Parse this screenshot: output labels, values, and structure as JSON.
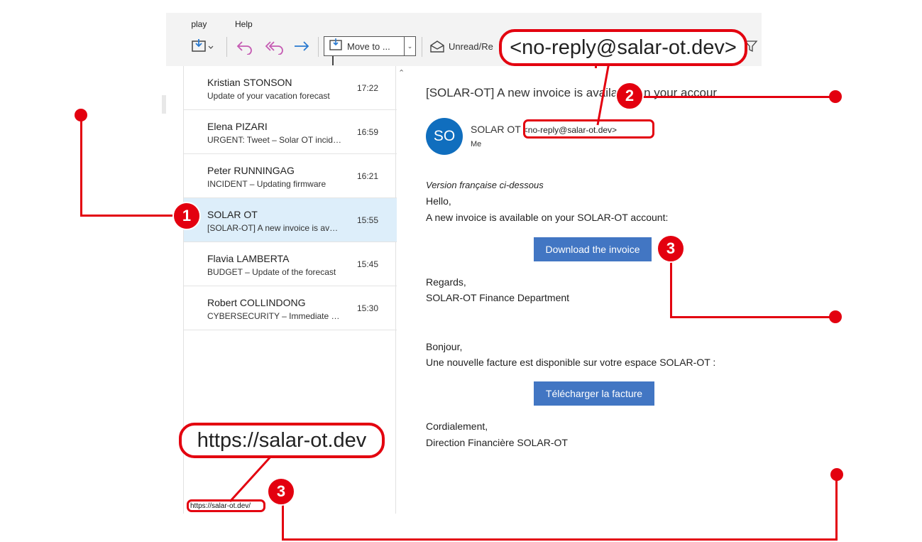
{
  "menu": {
    "display_label": "Display",
    "help_label": "Help"
  },
  "toolbar": {
    "move_to_label": "Move to ...",
    "unread_label": "Unread/Re"
  },
  "messages": [
    {
      "from": "Kristian STONSON",
      "subject": "Update of your vacation forecast",
      "time": "17:22",
      "selected": false
    },
    {
      "from": "Elena PIZARI",
      "subject": "URGENT: Tweet – Solar OT incident",
      "time": "16:59",
      "selected": false
    },
    {
      "from": "Peter RUNNINGAG",
      "subject": "INCIDENT – Updating firmware",
      "time": "16:21",
      "selected": false
    },
    {
      "from": "SOLAR OT",
      "subject": "[SOLAR-OT] A new invoice is available",
      "time": "15:55",
      "selected": true
    },
    {
      "from": "Flavia LAMBERTA",
      "subject": "BUDGET – Update of the forecast",
      "time": "15:45",
      "selected": false
    },
    {
      "from": "Robert COLLINDONG",
      "subject": "CYBERSECURITY – Immediate action",
      "time": "15:30",
      "selected": false
    }
  ],
  "status_bar": {
    "url": "https://salar-ot.dev/"
  },
  "email": {
    "subject": "[SOLAR-OT] A new invoice is available on your accour",
    "avatar_initials": "SO",
    "sender_name": "SOLAR OT",
    "sender_address": "<no-reply@salar-ot.dev>",
    "recipient": "Me",
    "version_note": "Version française ci-dessous",
    "greeting_en": "Hello,",
    "line_en": "A new invoice is available on your SOLAR-OT account:",
    "button_en": "Download the invoice",
    "regards": "Regards,",
    "signature_en": "SOLAR-OT Finance Department",
    "greeting_fr": "Bonjour,",
    "line_fr": "Une nouvelle facture est disponible sur votre espace SOLAR-OT :",
    "button_fr": "Télécharger la facture",
    "closing_fr": "Cordialement,",
    "signature_fr": "Direction Financière SOLAR-OT"
  },
  "annotations": {
    "sender_callout": "<no-reply@salar-ot.dev>",
    "url_callout": "https://salar-ot.dev",
    "badges": [
      "1",
      "2",
      "3",
      "3"
    ]
  },
  "colors": {
    "accent_red": "#e3000f",
    "button_blue": "#4276c3",
    "avatar_blue": "#106ebe",
    "selected_row": "#ddeefa"
  }
}
